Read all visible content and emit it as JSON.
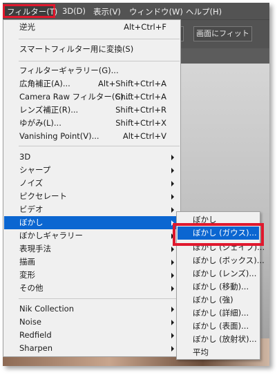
{
  "menubar": {
    "items": [
      {
        "label": "フィルター(T)"
      },
      {
        "label": "3D(D)"
      },
      {
        "label": "表示(V)"
      },
      {
        "label": "ウィンドウ(W)"
      },
      {
        "label": "ヘルプ(H)"
      }
    ]
  },
  "options_bar": {
    "fit_screen_label": "画面にフィット"
  },
  "filter_menu": {
    "items": [
      {
        "label": "逆光",
        "shortcut": "Alt+Ctrl+F"
      },
      {
        "label": "スマートフィルター用に変換(S)",
        "shortcut": ""
      },
      {
        "label": "フィルターギャラリー(G)...",
        "shortcut": ""
      },
      {
        "label": "広角補正(A)...",
        "shortcut": "Alt+Shift+Ctrl+A"
      },
      {
        "label": "Camera Raw フィルター(C)...",
        "shortcut": "Shift+Ctrl+A"
      },
      {
        "label": "レンズ補正(R)...",
        "shortcut": "Shift+Ctrl+R"
      },
      {
        "label": "ゆがみ(L)...",
        "shortcut": "Shift+Ctrl+X"
      },
      {
        "label": "Vanishing Point(V)...",
        "shortcut": "Alt+Ctrl+V"
      },
      {
        "label": "3D"
      },
      {
        "label": "シャープ"
      },
      {
        "label": "ノイズ"
      },
      {
        "label": "ピクセレート"
      },
      {
        "label": "ビデオ"
      },
      {
        "label": "ぼかし"
      },
      {
        "label": "ぼかしギャラリー"
      },
      {
        "label": "表現手法"
      },
      {
        "label": "描画"
      },
      {
        "label": "変形"
      },
      {
        "label": "その他"
      },
      {
        "label": "Nik Collection"
      },
      {
        "label": "Noise"
      },
      {
        "label": "Redfield"
      },
      {
        "label": "Sharpen"
      }
    ]
  },
  "blur_submenu": {
    "items": [
      {
        "label": "ぼかし"
      },
      {
        "label": "ぼかし (ガウス)..."
      },
      {
        "label": "ぼかし (シェイプ)..."
      },
      {
        "label": "ぼかし (ボックス)..."
      },
      {
        "label": "ぼかし (レンズ)..."
      },
      {
        "label": "ぼかし (移動)..."
      },
      {
        "label": "ぼかし (強)"
      },
      {
        "label": "ぼかし (詳細)..."
      },
      {
        "label": "ぼかし (表面)..."
      },
      {
        "label": "ぼかし (放射状)..."
      },
      {
        "label": "平均"
      }
    ]
  },
  "colors": {
    "highlight_red": "#e0182d",
    "selection_blue": "#0b66d1",
    "menubar_bg": "#535353"
  }
}
